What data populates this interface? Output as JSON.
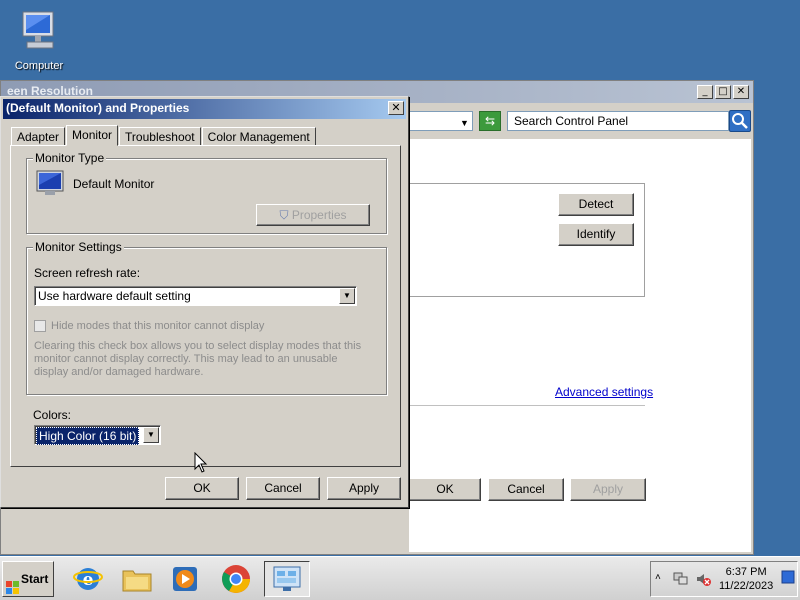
{
  "desktop": {
    "computer_label": "Computer"
  },
  "bg_window": {
    "title": "een Resolution",
    "search_placeholder": "Search Control Panel",
    "detect_label": "Detect",
    "identify_label": "Identify",
    "advanced_label": "Advanced settings",
    "ok_label": "OK",
    "cancel_label": "Cancel",
    "apply_label": "Apply"
  },
  "dialog": {
    "title": "(Default Monitor) and  Properties",
    "tabs": [
      "Adapter",
      "Monitor",
      "Troubleshoot",
      "Color Management"
    ],
    "active_tab": "Monitor",
    "monitor_type_label": "Monitor Type",
    "monitor_name": "Default Monitor",
    "properties_label": "Properties",
    "monitor_settings_label": "Monitor Settings",
    "refresh_label": "Screen refresh rate:",
    "refresh_value": "Use hardware default setting",
    "hide_modes_label": "Hide modes that this monitor cannot display",
    "help_text": "Clearing this check box allows you to select display modes that this monitor cannot display correctly. This may lead to an unusable display and/or damaged hardware.",
    "colors_label": "Colors:",
    "colors_value": "High Color (16 bit)",
    "ok_label": "OK",
    "cancel_label": "Cancel",
    "apply_label": "Apply"
  },
  "taskbar": {
    "start_label": "Start",
    "time": "6:37 PM",
    "date": "11/22/2023",
    "apps": [
      "internet-explorer-icon",
      "file-explorer-icon",
      "media-player-icon",
      "chrome-icon",
      "control-panel-icon"
    ]
  }
}
